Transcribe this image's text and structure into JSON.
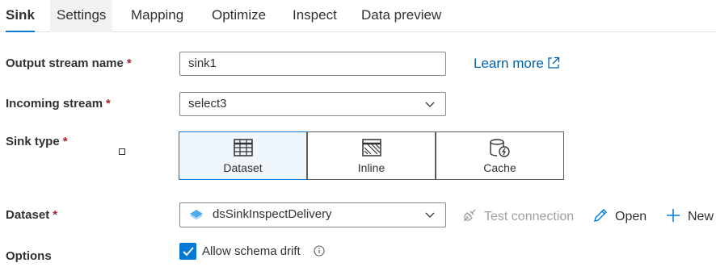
{
  "tabs": [
    {
      "label": "Sink"
    },
    {
      "label": "Settings"
    },
    {
      "label": "Mapping"
    },
    {
      "label": "Optimize"
    },
    {
      "label": "Inspect"
    },
    {
      "label": "Data preview"
    }
  ],
  "form": {
    "output_stream": {
      "label": "Output stream name",
      "required": "*",
      "value": "sink1"
    },
    "learn_more": "Learn more",
    "incoming_stream": {
      "label": "Incoming stream",
      "required": "*",
      "value": "select3"
    },
    "sink_type": {
      "label": "Sink type",
      "required": "*",
      "options": [
        {
          "label": "Dataset",
          "icon": "table-icon",
          "selected": true
        },
        {
          "label": "Inline",
          "icon": "inline-icon",
          "selected": false
        },
        {
          "label": "Cache",
          "icon": "cache-icon",
          "selected": false
        }
      ]
    },
    "dataset": {
      "label": "Dataset",
      "required": "*",
      "value": "dsSinkInspectDelivery"
    },
    "actions": {
      "test_connection": "Test connection",
      "open": "Open",
      "new": "New"
    },
    "options": {
      "label": "Options",
      "allow_schema_drift": "Allow schema drift",
      "allow_schema_drift_checked": true
    }
  },
  "colors": {
    "accent": "#0078d4",
    "link": "#0062ad",
    "required": "#a4262c"
  }
}
